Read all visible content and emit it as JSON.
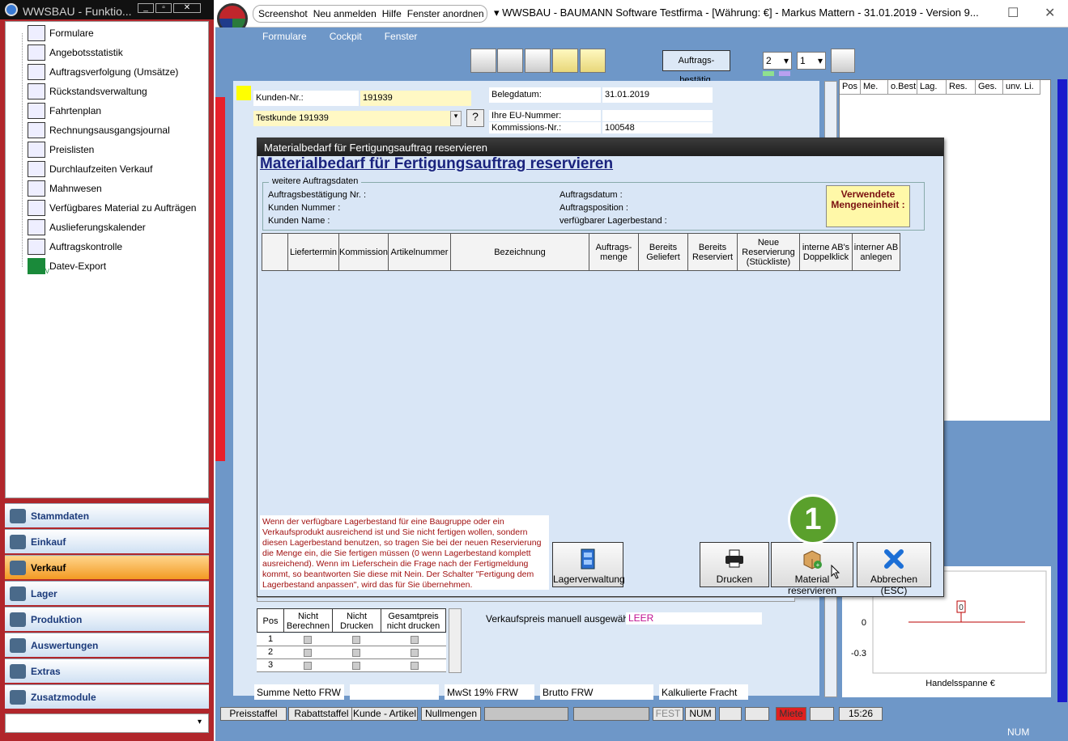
{
  "left_window": {
    "title": "WWSBAU - Funktio...",
    "tree_items": [
      {
        "label": "Formulare",
        "icon": "document-icon"
      },
      {
        "label": "Angebotsstatistik",
        "icon": "chart-icon"
      },
      {
        "label": "Auftragsverfolgung (Umsätze)",
        "icon": "tracking-icon"
      },
      {
        "label": "Rückstandsverwaltung",
        "icon": "clock-icon"
      },
      {
        "label": "Fahrtenplan",
        "icon": "truck-icon"
      },
      {
        "label": "Rechnungsausgangsjournal",
        "icon": "journal-icon"
      },
      {
        "label": "Preislisten",
        "icon": "price-tag-icon"
      },
      {
        "label": "Durchlaufzeiten Verkauf",
        "icon": "hourglass-icon"
      },
      {
        "label": "Mahnwesen",
        "icon": "dunning-icon"
      },
      {
        "label": "Verfügbares Material zu Aufträgen",
        "icon": "pencil-icon"
      },
      {
        "label": "Auslieferungskalender",
        "icon": "calendar-icon"
      },
      {
        "label": "Auftragskontrolle",
        "icon": "clipboard-icon"
      },
      {
        "label": "Datev-Export",
        "icon": "datev-icon"
      }
    ],
    "datev_label": "DATEV",
    "nav_sections": [
      {
        "label": "Stammdaten",
        "active": false
      },
      {
        "label": "Einkauf",
        "active": false
      },
      {
        "label": "Verkauf",
        "active": true
      },
      {
        "label": "Lager",
        "active": false
      },
      {
        "label": "Produktion",
        "active": false
      },
      {
        "label": "Auswertungen",
        "active": false
      },
      {
        "label": "Extras",
        "active": false
      },
      {
        "label": "Zusatzmodule",
        "active": false
      }
    ]
  },
  "main_window": {
    "menu": [
      "Screenshot",
      "Neu anmelden",
      "Hilfe",
      "Fenster anordnen"
    ],
    "title": "WWSBAU - BAUMANN Software Testfirma - [Währung: €] -   Markus Mattern - 31.01.2019 - Version 9...",
    "menubar": [
      "Formulare",
      "Cockpit",
      "Fenster"
    ],
    "toolbar_confirm": "Auftrags- bestätig.",
    "copies_1": "2",
    "copies_2": "1",
    "form": {
      "kunden_nr_label": "Kunden-Nr.:",
      "kunden_nr": "191939",
      "kunde": "Testkunde 191939",
      "help": "?",
      "belegdatum_label": "Belegdatum:",
      "belegdatum": "31.01.2019",
      "eu_label": "Ihre EU-Nummer:",
      "kommission_label": "Kommissions-Nr.:",
      "kommission": "100548"
    },
    "right_grid_headers": [
      "Pos",
      "Me.",
      "o.Best",
      "Lag.",
      "Res.",
      "Ges.",
      "unv. Li."
    ],
    "chart": {
      "y_ticks": [
        "0",
        "-0.3"
      ],
      "data_label": "0",
      "xlabel": "Handelsspanne €"
    },
    "bottom_table": {
      "headers": [
        "Pos",
        "Nicht Berechnen",
        "Nicht Drucken",
        "Gesamtpreis nicht drucken"
      ],
      "rows": [
        "1",
        "2",
        "3"
      ]
    },
    "vk_manual_label": "Verkaufspreis manuell ausgewählt:",
    "vk_manual_value": "LEER",
    "sums": [
      "Summe Netto FRW",
      "MwSt 19% FRW",
      "Brutto FRW",
      "Kalkulierte Fracht"
    ],
    "status": [
      "Preisstaffel",
      "Rabattstaffel",
      "Kunde - Artikel",
      "Nullmengen",
      "FEST",
      "NUM",
      "Miete",
      "15:26"
    ],
    "bottom_num": "NUM"
  },
  "dialog": {
    "title": "Materialbedarf für Fertigungsauftrag reservieren",
    "heading": "Materialbedarf für Fertigungsauftrag reservieren",
    "group_label": "weitere Auftragsdaten",
    "fields_left": [
      "Auftragsbestätigung Nr. :",
      "Kunden Nummer :",
      "Kunden Name :"
    ],
    "fields_right": [
      "Auftragsdatum :",
      "Auftragsposition :",
      "verfügbarer Lagerbestand :"
    ],
    "mengeneinheit": "Verwendete Mengeneinheit :",
    "columns": [
      "",
      "Liefertermin",
      "Kommission",
      "Artikelnummer",
      "Bezeichnung",
      "Auftrags- menge",
      "Bereits Geliefert",
      "Bereits Reserviert",
      "Neue Reservierung (Stückliste)",
      "interne AB's Doppelklick",
      "interner AB anlegen"
    ],
    "info_text": "Wenn der verfügbare Lagerbestand für eine Baugruppe oder ein Verkaufsprodukt ausreichend ist und Sie nicht fertigen wollen, sondern diesen Lagerbestand benutzen, so tragen Sie bei der neuen Reservierung die Menge ein, die Sie fertigen müssen (0 wenn Lagerbestand komplett ausreichend). Wenn im Lieferschein die Frage nach der Fertigmeldung kommt, so beantworten Sie diese mit Nein. Der Schalter \"Fertigung dem Lagerbestand anpassen\", wird das für Sie übernehmen.",
    "buttons": {
      "lager": "Lagerverwaltung",
      "drucken": "Drucken",
      "material": "Material reservieren",
      "abbrechen": "Abbrechen (ESC)"
    },
    "badge": "1"
  }
}
